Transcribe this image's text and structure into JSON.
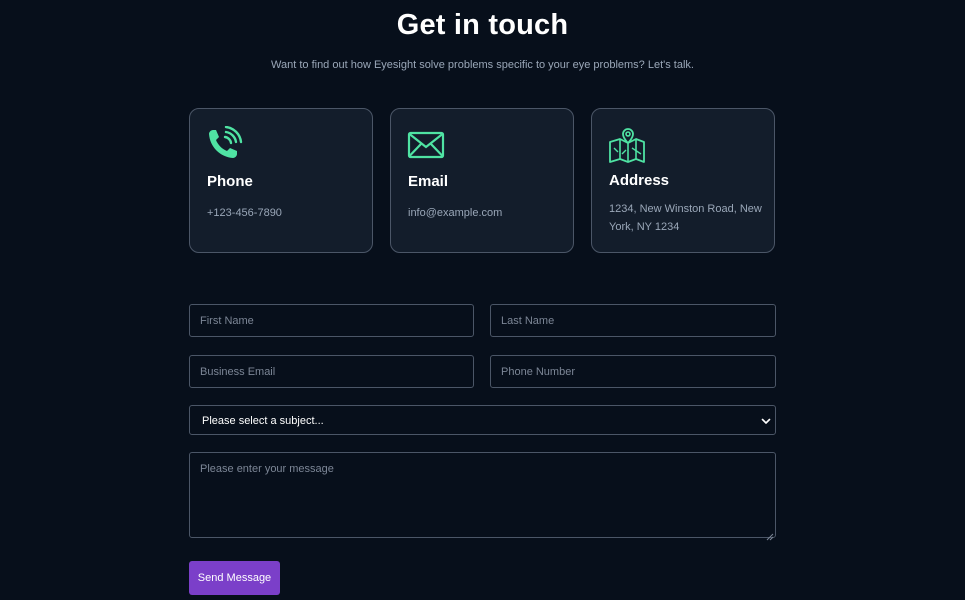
{
  "header": {
    "title": "Get in touch",
    "subtitle": "Want to find out how Eyesight solve problems specific to your eye problems? Let's talk."
  },
  "cards": [
    {
      "icon": "phone-icon",
      "title": "Phone",
      "text": "+123-456-7890"
    },
    {
      "icon": "envelope-icon",
      "title": "Email",
      "text": "info@example.com"
    },
    {
      "icon": "map-pin-icon",
      "title": "Address",
      "text": "1234, New Winston Road, New York, NY 1234"
    }
  ],
  "form": {
    "first_name": {
      "placeholder": "First Name",
      "value": ""
    },
    "last_name": {
      "placeholder": "Last Name",
      "value": ""
    },
    "business_email": {
      "placeholder": "Business Email",
      "value": ""
    },
    "phone_number": {
      "placeholder": "Phone Number",
      "value": ""
    },
    "subject": {
      "selected": "Please select a subject..."
    },
    "message": {
      "placeholder": "Please enter your message",
      "value": ""
    },
    "submit_label": "Send Message"
  },
  "colors": {
    "background": "#070f1b",
    "card_background": "#131d2b",
    "icon_accent": "#4fe3a3",
    "button": "#7b3fc9",
    "border": "#4b5667"
  }
}
